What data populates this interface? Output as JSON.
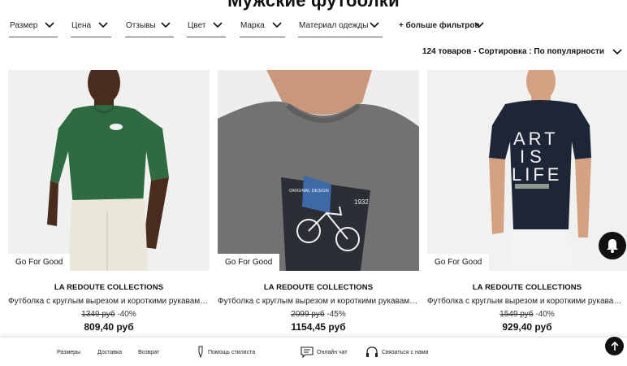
{
  "page": {
    "title": "Мужские футболки"
  },
  "filters": [
    {
      "label": "Размер"
    },
    {
      "label": "Цена"
    },
    {
      "label": "Отзывы"
    },
    {
      "label": "Цвет"
    },
    {
      "label": "Марка"
    },
    {
      "label": "Материал одежды"
    },
    {
      "label": "+ больше фильтров"
    }
  ],
  "results": {
    "count_text": "124 товаров",
    "separator": "-",
    "sort_text": "Сортировка : По популярности"
  },
  "products": [
    {
      "brand": "LA REDOUTE COLLECTIONS",
      "name": "Футболка с круглым вырезом и короткими рукавами, в...",
      "old_price": "1349 руб",
      "discount": "-40%",
      "price": "809,40 руб",
      "badge": "Go For Good",
      "color": "#2f6b40"
    },
    {
      "brand": "LA REDOUTE COLLECTIONS",
      "name": "Футболка с круглым вырезом и короткими рукавами и р...",
      "old_price": "2099 руб",
      "discount": "-45%",
      "price": "1154,45 руб",
      "badge": "Go For Good",
      "color": "#6f6f6f"
    },
    {
      "brand": "LA REDOUTE COLLECTIONS",
      "name": "Футболка с круглым вырезом и короткими рукавами и р...",
      "old_price": "1549 руб",
      "discount": "-40%",
      "price": "929,40 руб",
      "badge": "Go For Good",
      "color": "#1d2537"
    }
  ],
  "tshirt_print": {
    "line1": "ART",
    "line2": "IS",
    "line3": "LIFE",
    "poster_small": "ORIGINAL DESIGN",
    "poster_year": "1932"
  },
  "footer": {
    "sizes": "Размеры",
    "delivery": "Доставка",
    "returns": "Возврат",
    "stylist": "Помощь стилиста",
    "chat": "Онлайн чат",
    "contact": "Связаться с нами"
  }
}
